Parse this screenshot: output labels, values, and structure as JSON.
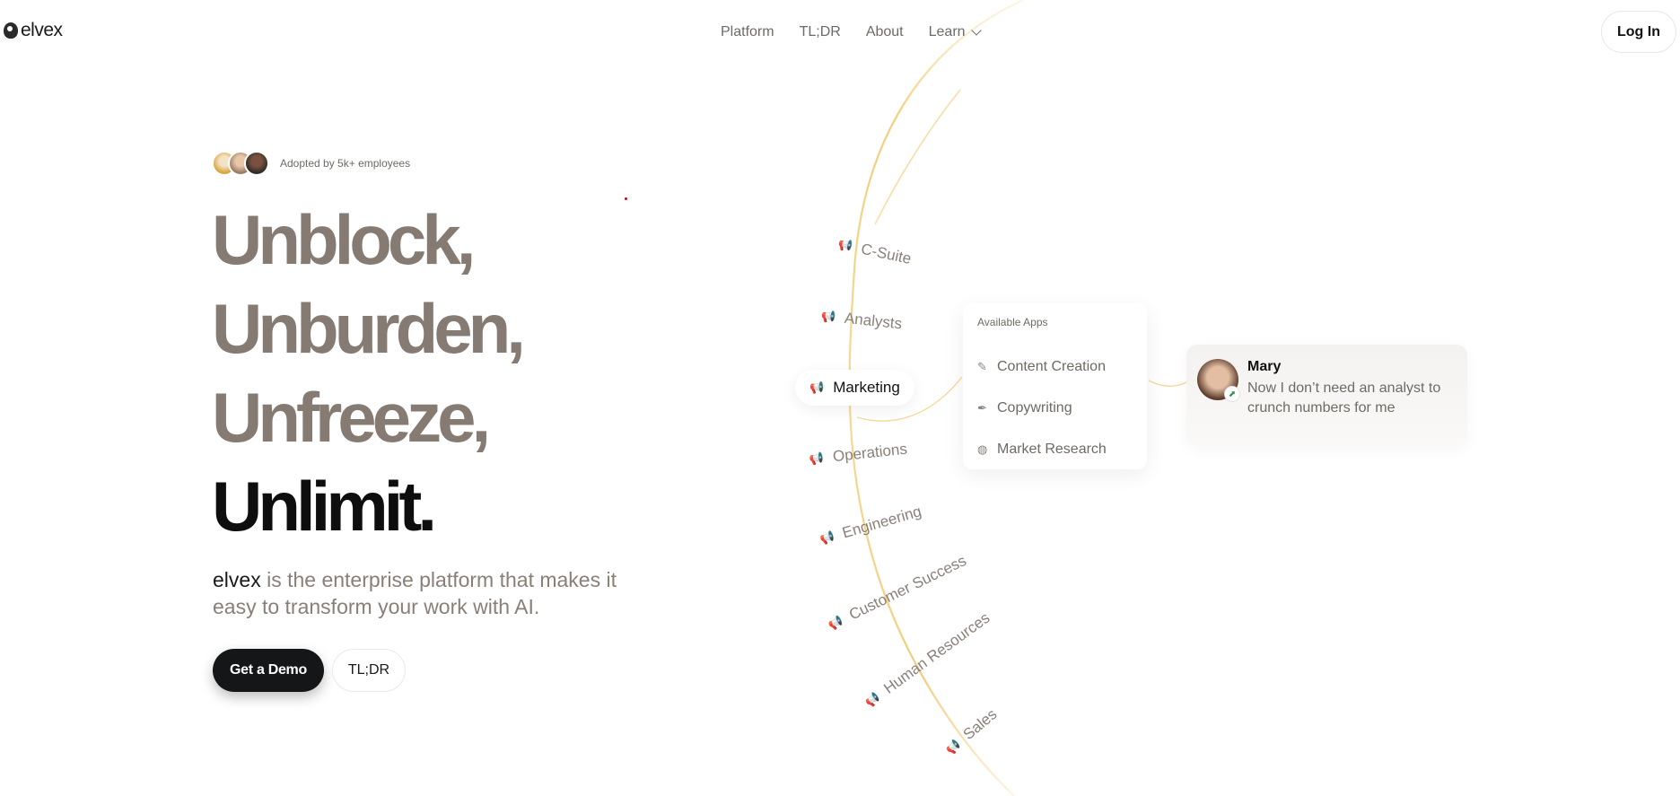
{
  "header": {
    "logo_text": "elvex",
    "nav": [
      "Platform",
      "TL;DR",
      "About",
      "Learn"
    ],
    "login_label": "Log In"
  },
  "hero": {
    "adopted_text": "Adopted by 5k+ employees",
    "headline": [
      "Unblock,",
      "Unburden,",
      "Unfreeze,",
      "Unlimit."
    ],
    "tagline_brand": "elvex",
    "tagline_rest": " is the enterprise platform that makes it easy to transform your work with AI.",
    "cta_primary": "Get a Demo",
    "cta_secondary": "TL;DR"
  },
  "departments": {
    "items": [
      "C-Suite",
      "Analysts",
      "Marketing",
      "Operations",
      "Engineering",
      "Customer Success",
      "Human Resources",
      "Sales"
    ],
    "active": "Marketing",
    "icon": "megaphone-icon"
  },
  "apps_panel": {
    "title": "Available Apps",
    "apps": [
      {
        "label": "Content Creation",
        "icon": "sparkle-tool-icon"
      },
      {
        "label": "Copywriting",
        "icon": "pen-icon"
      },
      {
        "label": "Market Research",
        "icon": "globe-search-icon"
      }
    ]
  },
  "testimonial": {
    "name": "Mary",
    "text": "Now I don’t need an analyst to crunch numbers for me",
    "badge_icon": "chart-icon"
  },
  "colors": {
    "accent_arc": "#f2c86e",
    "headline_muted": "#857b73",
    "primary_button": "#151617"
  }
}
